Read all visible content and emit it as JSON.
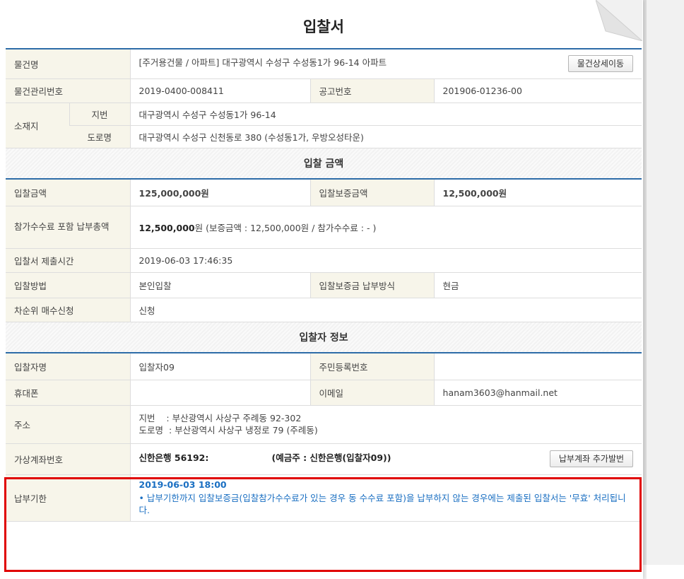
{
  "title": "입찰서",
  "item": {
    "name_label": "물건명",
    "name_value": "[주거용건물 / 아파트] 대구광역시 수성구 수성동1가 96-14 아파트",
    "detail_button": "물건상세이동",
    "mgmt_label": "물건관리번호",
    "mgmt_value": "2019-0400-008411",
    "notice_label": "공고번호",
    "notice_value": "201906-01236-00",
    "location_label": "소재지",
    "lot_label": "지번",
    "lot_value": "대구광역시 수성구 수성동1가 96-14",
    "road_label": "도로명",
    "road_value": "대구광역시 수성구 신천동로 380 (수성동1가, 우방오성타운)"
  },
  "amount": {
    "section_title": "입찰 금액",
    "bid_label": "입찰금액",
    "bid_value": "125,000,000원",
    "deposit_label": "입찰보증금액",
    "deposit_value": "12,500,000원",
    "total_label": "참가수수료 포함 납부총액",
    "total_value_bold": "12,500,000",
    "total_value_rest": "원 (보증금액 : 12,500,000원 / 참가수수료 : - )",
    "submit_time_label": "입찰서 제출시간",
    "submit_time_value": "2019-06-03 17:46:35",
    "method_label": "입찰방법",
    "method_value": "본인입찰",
    "deposit_pay_label": "입찰보증금 납부방식",
    "deposit_pay_value": "현금",
    "next_label": "차순위 매수신청",
    "next_value": "신청"
  },
  "bidder": {
    "section_title": "입찰자 정보",
    "name_label": "입찰자명",
    "name_value": "입찰자09",
    "rrn_label": "주민등록번호",
    "rrn_value": "",
    "phone_label": "휴대폰",
    "phone_value": "",
    "email_label": "이메일",
    "email_value": "hanam3603@hanmail.net",
    "address_label": "주소",
    "address_lot": "지번    : 부산광역시 사상구 주례동 92-302",
    "address_road": "도로명  : 부산광역시 사상구 냉정로 79 (주례동)"
  },
  "payment": {
    "account_label": "가상계좌번호",
    "account_value": "신한은행 56192:",
    "holder_value": "(예금주 : 신한은행(입찰자09))",
    "add_account_button": "납부계좌 추가발번",
    "deadline_label": "납부기한",
    "deadline_value": "2019-06-03 18:00",
    "deadline_note": "• 납부기한까지 입찰보증금(입찰참가수수료가 있는 경우 동 수수료 포함)을 납부하지 않는 경우에는 제출된 입찰서는 '무효' 처리됩니다."
  },
  "colors": {
    "header_border": "#2d6ca8",
    "label_bg": "#f7f5ea",
    "highlight": "#e00000",
    "note_blue": "#1a6fc2"
  }
}
